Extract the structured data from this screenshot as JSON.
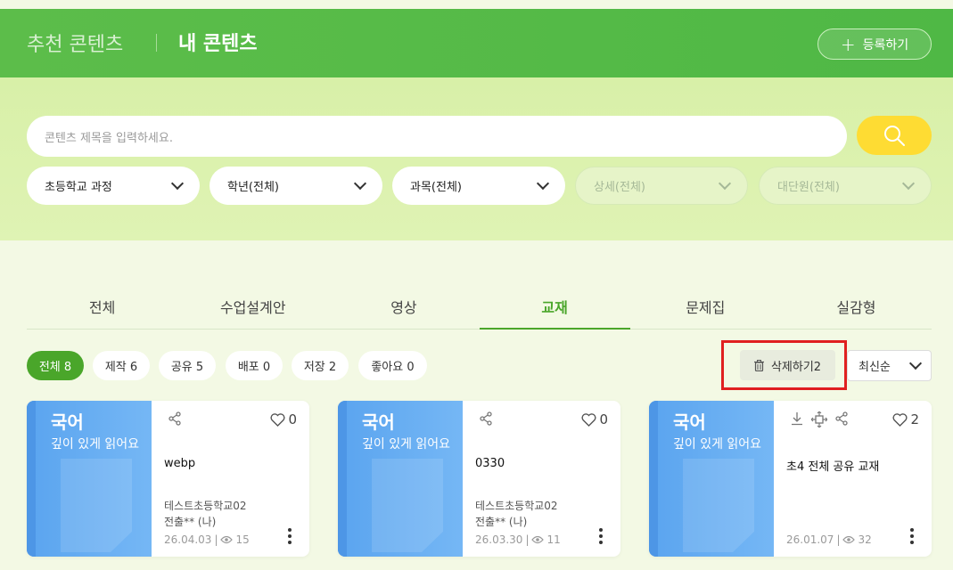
{
  "header": {
    "tab_recommended": "추천 콘텐츠",
    "tab_mine": "내 콘텐츠",
    "register_label": "등록하기"
  },
  "search": {
    "placeholder": "콘텐츠 제목을 입력하세요."
  },
  "filters": [
    {
      "label": "초등학교 과정",
      "enabled": true
    },
    {
      "label": "학년(전체)",
      "enabled": true
    },
    {
      "label": "과목(전체)",
      "enabled": true
    },
    {
      "label": "상세(전체)",
      "enabled": false
    },
    {
      "label": "대단원(전체)",
      "enabled": false
    }
  ],
  "tabs": [
    {
      "label": "전체"
    },
    {
      "label": "수업설계안"
    },
    {
      "label": "영상"
    },
    {
      "label": "교재",
      "active": true
    },
    {
      "label": "문제집"
    },
    {
      "label": "실감형"
    }
  ],
  "chips": [
    {
      "label": "전체 8",
      "active": true
    },
    {
      "label": "제작 6"
    },
    {
      "label": "공유 5"
    },
    {
      "label": "배포 0"
    },
    {
      "label": "저장 2"
    },
    {
      "label": "좋아요 0"
    }
  ],
  "actions": {
    "delete_label": "삭제하기2",
    "sort_label": "최신순"
  },
  "cards": [
    {
      "subject": "국어",
      "cover_title": "깊이 있게 읽어요",
      "name": "webp",
      "school": "테스트초등학교02",
      "author": "전출** (나)",
      "date": "26.04.03",
      "views": "15",
      "likes": "0",
      "icons": [
        "share-icon"
      ]
    },
    {
      "subject": "국어",
      "cover_title": "깊이 있게 읽어요",
      "name": "0330",
      "school": "테스트초등학교02",
      "author": "전출** (나)",
      "date": "26.03.30",
      "views": "11",
      "likes": "0",
      "icons": [
        "share-icon"
      ]
    },
    {
      "subject": "국어",
      "cover_title": "깊이 있게 읽어요",
      "name": "초4 전체 공유 교재",
      "school": "",
      "author": "",
      "date": "26.01.07",
      "views": "32",
      "likes": "2",
      "icons": [
        "download-icon",
        "distribute-icon",
        "share-icon"
      ]
    }
  ],
  "colors": {
    "header_green": "#4fb845",
    "active_green": "#4aa62a",
    "search_yellow": "#fedc33",
    "cover_blue": "#5aa4ef",
    "highlight_red": "#e02020"
  }
}
